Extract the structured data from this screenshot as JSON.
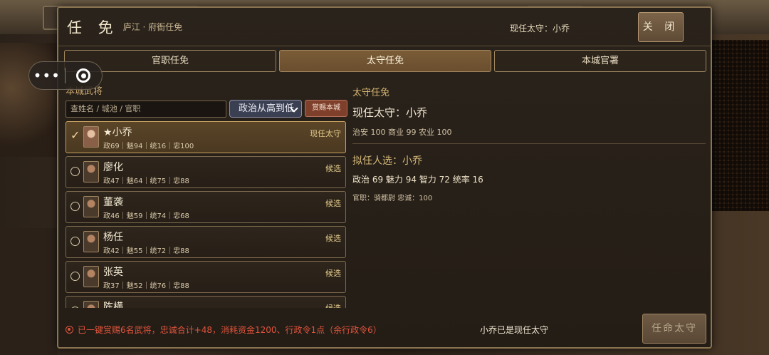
{
  "dialog": {
    "title": "任 免",
    "subtitle": "庐江 · 府衙任免",
    "current_governor": "现任太守：小乔",
    "close_label": "关 闭"
  },
  "tabs": [
    {
      "label": "官职任免",
      "active": false
    },
    {
      "label": "太守任免",
      "active": true
    },
    {
      "label": "本城官署",
      "active": false
    }
  ],
  "left": {
    "title": "本城武将",
    "search_placeholder": "查姓名 / 城池 / 官职",
    "sort_selected": "政治从高到低",
    "reward_label": "赏赐本城"
  },
  "generals": [
    {
      "name": "★小乔",
      "stats": "政69｜魅94｜统16｜忠100",
      "status": "现任太守",
      "selected": true
    },
    {
      "name": "廖化",
      "stats": "政47｜魅64｜统75｜忠88",
      "status": "候选",
      "selected": false
    },
    {
      "name": "董袭",
      "stats": "政46｜魅59｜统74｜忠68",
      "status": "候选",
      "selected": false
    },
    {
      "name": "杨任",
      "stats": "政42｜魅55｜统72｜忠88",
      "status": "候选",
      "selected": false
    },
    {
      "name": "张英",
      "stats": "政37｜魅52｜统76｜忠88",
      "status": "候选",
      "selected": false
    },
    {
      "name": "陈横",
      "stats": "",
      "status": "候选",
      "selected": false
    }
  ],
  "right": {
    "title": "太守任免",
    "current": "现任太守：小乔",
    "city_stats": "治安 100    商业 99    农业 100",
    "candidate": "拟任人选：小乔",
    "candidate_stats": "政治 69    魅力 94    智力 72    统率 16",
    "candidate_info": "官职：骑都尉    忠诚：100"
  },
  "footer": {
    "notice": "已一键赏赐6名武将，忠诚合计+48，消耗资金1200、行政令1点（余行政令6）",
    "status": "小乔已是现任太守",
    "appoint_label": "任命太守"
  },
  "icons": {
    "more": "more-dots-icon",
    "target": "target-icon",
    "check": "checkmark-icon",
    "radio": "radio-icon",
    "notice": "notice-icon",
    "chevron": "chevron-down-icon"
  },
  "colors": {
    "accent_gold": "#c9a462",
    "active_tab": "#7a5c37",
    "warning_red": "#e0543c",
    "sort_bg": "#3a3f52"
  }
}
